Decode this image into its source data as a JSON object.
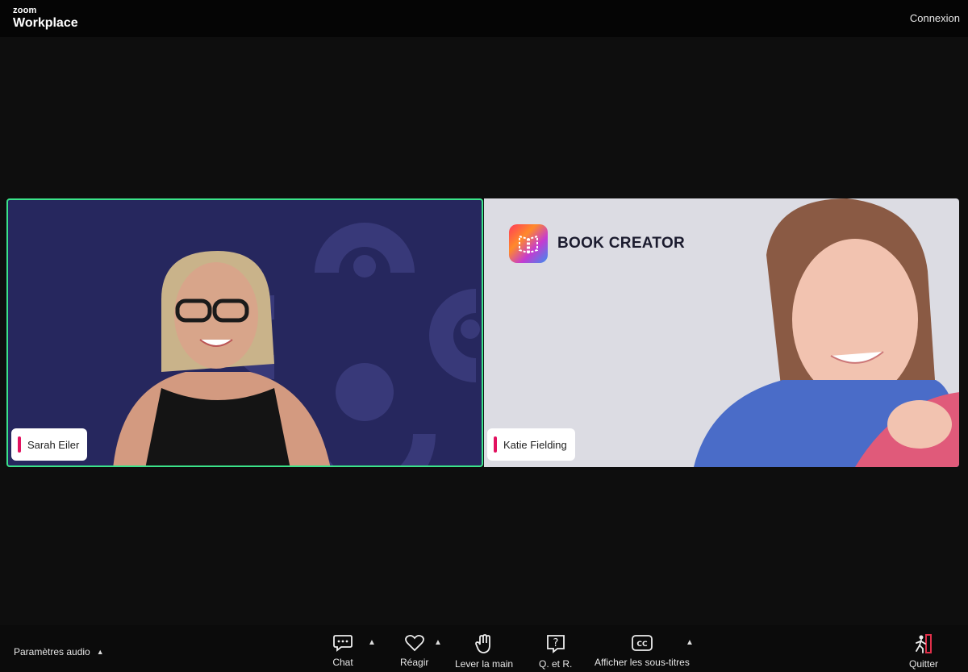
{
  "header": {
    "brand_small": "zoom",
    "brand_big": "Workplace",
    "signin_label": "Connexion"
  },
  "participants": [
    {
      "name": "Sarah Eiler"
    },
    {
      "name": "Katie Fielding"
    }
  ],
  "background_logo": {
    "text": "BOOK CREATOR"
  },
  "toolbar": {
    "audio_settings": "Paramètres audio",
    "items": [
      {
        "label": "Chat",
        "icon": "chat-icon"
      },
      {
        "label": "Réagir",
        "icon": "heart-icon"
      },
      {
        "label": "Lever la main",
        "icon": "hand-icon"
      },
      {
        "label": "Q. et R.",
        "icon": "question-icon"
      },
      {
        "label": "Afficher les sous-titres",
        "icon": "cc-icon"
      },
      {
        "label": "Quitter",
        "icon": "leave-icon"
      }
    ]
  },
  "colors": {
    "active_speaker_border": "#3be38a",
    "name_tag_accent": "#e2115f",
    "leave_accent": "#e0304a"
  }
}
